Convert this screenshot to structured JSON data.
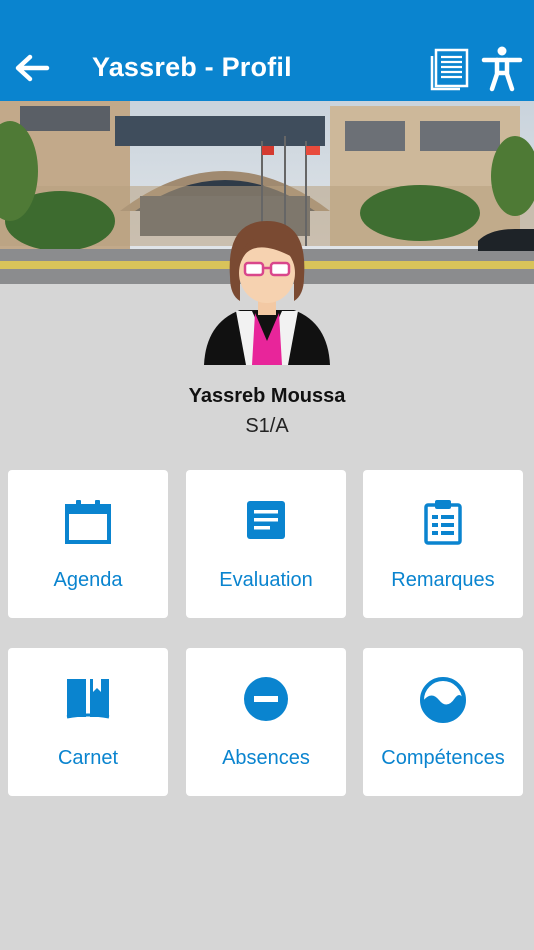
{
  "header": {
    "title": "Yassreb - Profil",
    "back_icon": "arrow-left-icon",
    "doc_icon": "document-list-icon",
    "a11y_icon": "accessibility-icon",
    "bg_color": "#0a84cf"
  },
  "banner": {
    "alt": "school-building-photo"
  },
  "student": {
    "name": "Yassreb Moussa",
    "class": "S1/A"
  },
  "tiles": [
    {
      "label": "Agenda",
      "icon": "calendar-icon"
    },
    {
      "label": "Evaluation",
      "icon": "document-icon"
    },
    {
      "label": "Remarques",
      "icon": "clipboard-icon"
    },
    {
      "label": "Carnet",
      "icon": "book-icon"
    },
    {
      "label": "Absences",
      "icon": "minus-circle-icon"
    },
    {
      "label": "Compétences",
      "icon": "wave-circle-icon"
    }
  ],
  "colors": {
    "accent": "#0a84cf",
    "background": "#d6d6d6",
    "tile": "#ffffff"
  }
}
